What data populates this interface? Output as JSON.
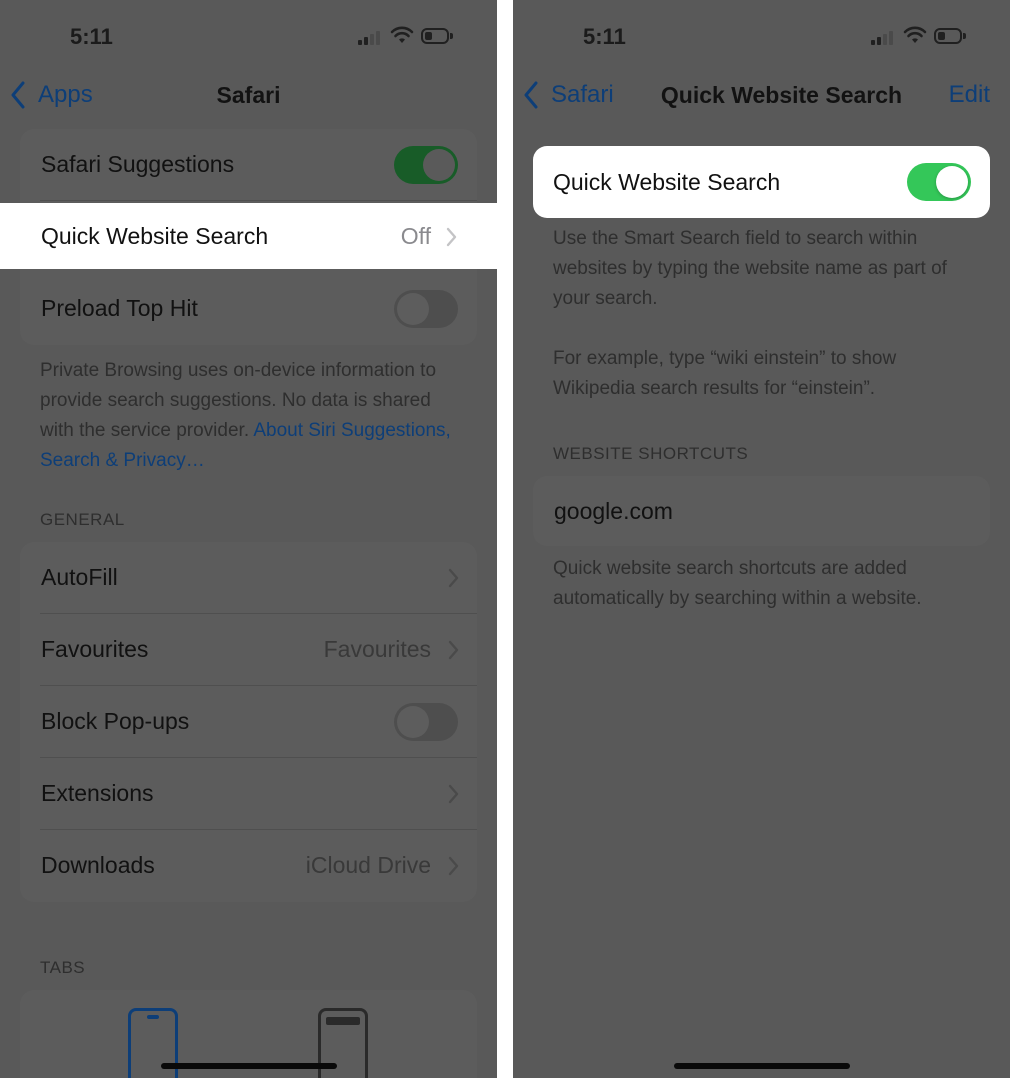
{
  "left": {
    "status": {
      "time": "5:11"
    },
    "nav": {
      "back_label": "Apps",
      "title": "Safari"
    },
    "top_group": {
      "safari_suggestions": {
        "label": "Safari Suggestions",
        "toggle": "on"
      },
      "quick_website_search": {
        "label": "Quick Website Search",
        "value": "Off"
      },
      "preload_top_hit": {
        "label": "Preload Top Hit",
        "toggle": "off"
      }
    },
    "footer": {
      "text": "Private Browsing uses on-device information to provide search suggestions. No data is shared with the service provider.",
      "link": "About Siri Suggestions, Search & Privacy…"
    },
    "general": {
      "header": "GENERAL",
      "autofill": {
        "label": "AutoFill"
      },
      "favourites": {
        "label": "Favourites",
        "value": "Favourites"
      },
      "block_popups": {
        "label": "Block Pop-ups",
        "toggle": "off"
      },
      "extensions": {
        "label": "Extensions"
      },
      "downloads": {
        "label": "Downloads",
        "value": "iCloud Drive"
      }
    },
    "tabs": {
      "header": "TABS"
    }
  },
  "right": {
    "status": {
      "time": "5:11"
    },
    "nav": {
      "back_label": "Safari",
      "title": "Quick Website Search",
      "edit_label": "Edit"
    },
    "quick_website_search": {
      "label": "Quick Website Search",
      "toggle": "on"
    },
    "description_1": "Use the Smart Search field to search within websites by typing the website name as part of your search.",
    "description_2": "For example, type “wiki einstein” to show Wikipedia search results for “einstein”.",
    "shortcuts": {
      "header": "WEBSITE SHORTCUTS",
      "items": [
        "google.com"
      ],
      "footer": "Quick website search shortcuts are added automatically by searching within a website."
    }
  },
  "colors": {
    "dim_overlay": "#595959",
    "highlight": "#ffffff",
    "toggle_on_active": "#34c759",
    "toggle_on_dimmed": "#185c28",
    "link_dimmed": "#0d3e78"
  }
}
